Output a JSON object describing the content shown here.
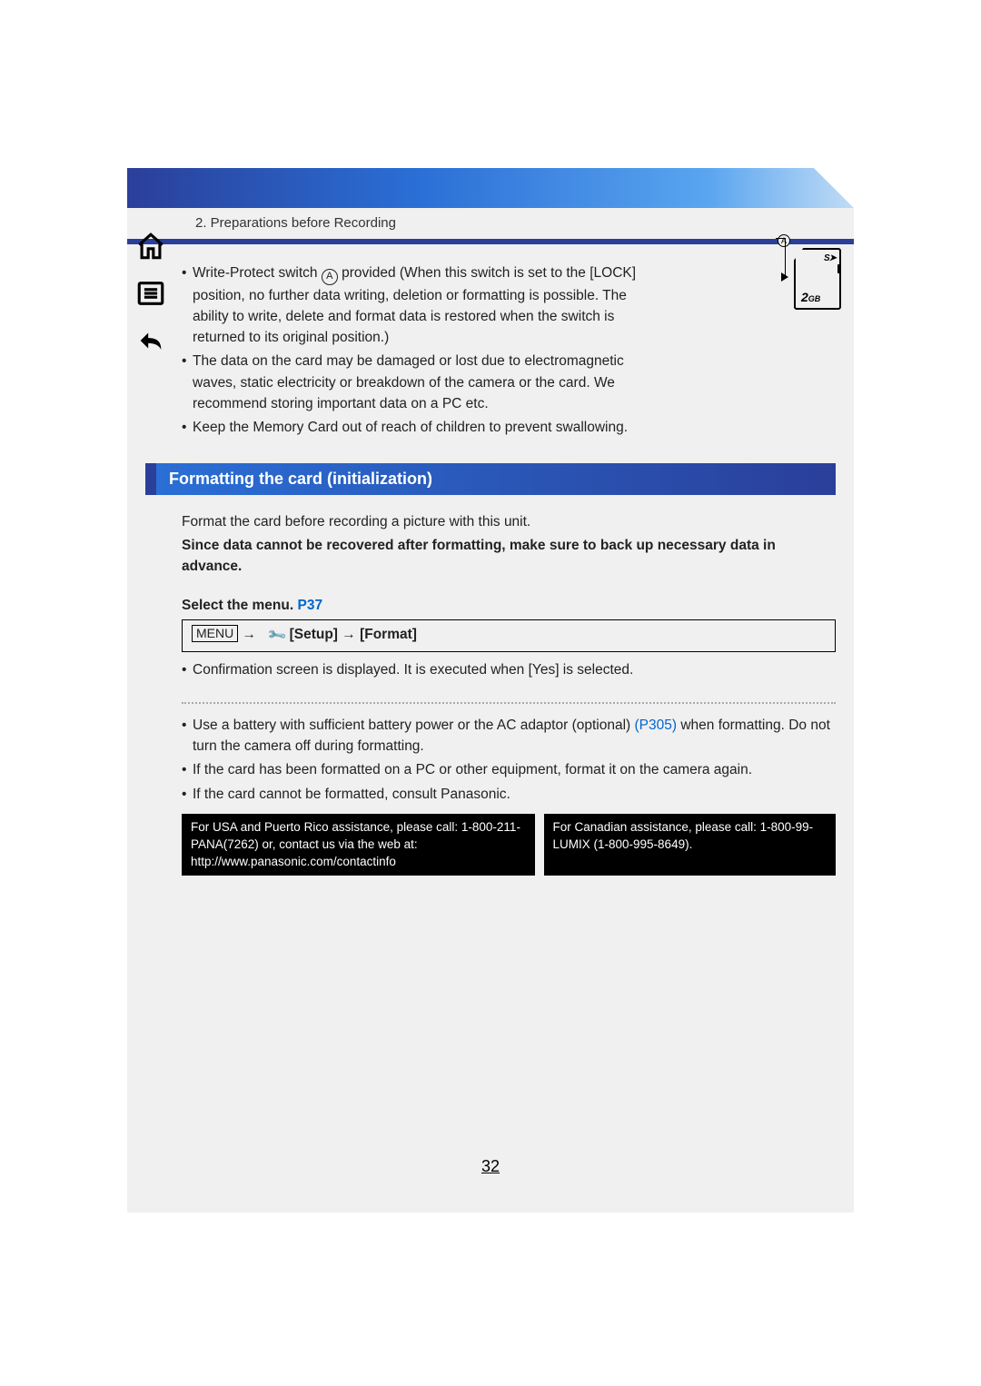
{
  "breadcrumb": "2. Preparations before Recording",
  "circle_a": "A",
  "bullets_top": [
    {
      "pre": "Write-Protect switch ",
      "post": " provided (When this switch is set to the [LOCK] position, no further data writing, deletion or formatting is possible. The ability to write, delete and format data is restored when the switch is returned to its original position.)"
    },
    {
      "text": "The data on the card may be damaged or lost due to electromagnetic waves, static electricity or breakdown of the camera or the card. We recommend storing important data on a PC etc."
    },
    {
      "text": "Keep the Memory Card out of reach of children to prevent swallowing."
    }
  ],
  "sd": {
    "label": "A",
    "logo": "S➤",
    "capacity_num": "2",
    "capacity_unit": "GB"
  },
  "section_title": "Formatting the card (initialization)",
  "para1": "Format the card before recording a picture with this unit.",
  "para2": "Since data cannot be recovered after formatting, make sure to back up necessary data in advance.",
  "select_label": "Select the menu.",
  "select_ref": "P37",
  "menu_label": "MENU",
  "arrow": "→",
  "cmd_rest": "[Setup] → [Format]",
  "confirm": "Confirmation screen is displayed. It is executed when [Yes] is selected.",
  "notes2": [
    {
      "pre": "Use a battery with sufficient battery power or the AC adaptor (optional) ",
      "link": "(P305)",
      "post": " when formatting. Do not turn the camera off during formatting."
    },
    {
      "text": "If the card has been formatted on a PC or other equipment, format it on the camera again."
    },
    {
      "text": "If the card cannot be formatted, consult Panasonic."
    }
  ],
  "contact_usa": "For USA and Puerto Rico assistance, please call: 1-800-211-PANA(7262) or, contact us via the web at: http://www.panasonic.com/contactinfo",
  "contact_ca": "For Canadian assistance, please call: 1-800-99-LUMIX (1-800-995-8649).",
  "page_number": "32",
  "icons": {
    "home": "home-icon",
    "toc": "toc-icon",
    "back": "back-icon"
  }
}
